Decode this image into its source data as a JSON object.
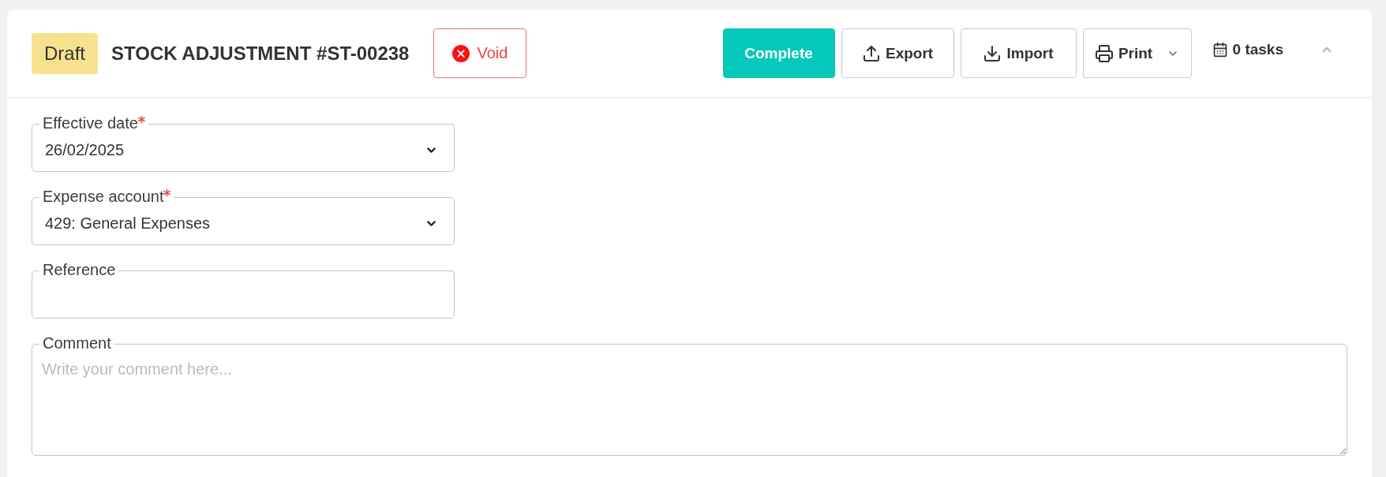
{
  "header": {
    "status_badge": "Draft",
    "title": "STOCK ADJUSTMENT #ST-00238",
    "void_button": {
      "label": "Void"
    },
    "actions": [
      {
        "kind": "primary",
        "label": "Complete",
        "dropdown": false
      },
      {
        "kind": "export",
        "label": "Export",
        "dropdown": false
      },
      {
        "kind": "import",
        "label": "Import",
        "dropdown": false
      },
      {
        "kind": "print",
        "label": "Print",
        "dropdown": true
      }
    ],
    "tasks": "0 tasks",
    "expanded": true
  },
  "fields": [
    {
      "kind": "select",
      "label": "Effective date",
      "required": true,
      "value": "26/02/2025"
    },
    {
      "kind": "select",
      "label": "Expense account",
      "required": true,
      "value": "429: General Expenses"
    },
    {
      "kind": "text",
      "label": "Reference",
      "required": false
    },
    {
      "kind": "textarea",
      "label": "Comment",
      "required": false,
      "placeholder": "Write your comment here..."
    }
  ]
}
